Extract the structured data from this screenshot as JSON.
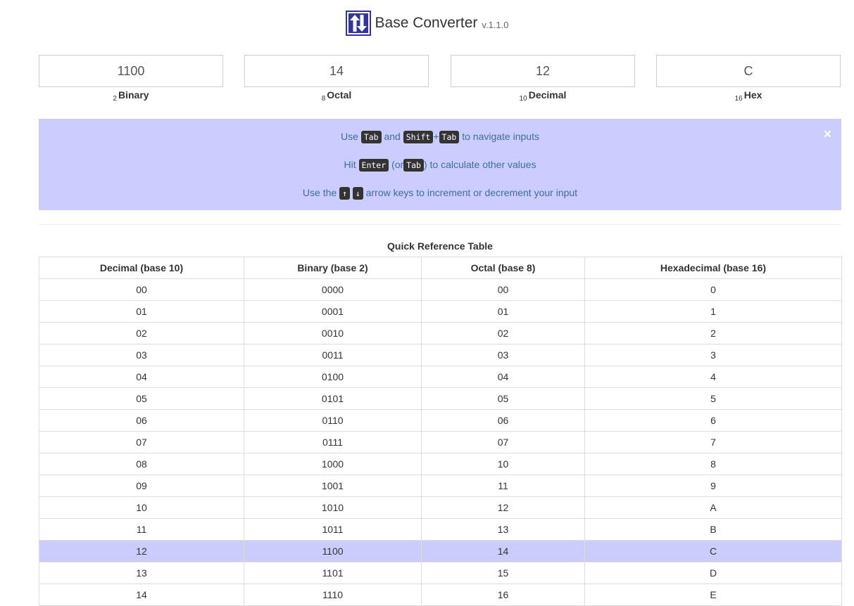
{
  "app": {
    "title": "Base Converter",
    "version": "v.1.1.0"
  },
  "converters": [
    {
      "value": "1100",
      "base": "2",
      "label": "Binary"
    },
    {
      "value": "14",
      "base": "8",
      "label": "Octal"
    },
    {
      "value": "12",
      "base": "10",
      "label": "Decimal"
    },
    {
      "value": "C",
      "base": "16",
      "label": "Hex"
    }
  ],
  "hints": {
    "l1_use": "Use",
    "l1_and": "and",
    "l1_plus": "+",
    "l1_end": "to navigate inputs",
    "l2_hit": "Hit",
    "l2_or": "(or",
    "l2_end": ") to calculate other values",
    "l3_use": "Use the",
    "l3_end": "arrow keys to increment or decrement your input",
    "keys": {
      "tab": "Tab",
      "shift": "Shift",
      "enter": "Enter",
      "up": "↑",
      "down": "↓"
    },
    "close": "×"
  },
  "table": {
    "caption": "Quick Reference Table",
    "headers": [
      "Decimal (base 10)",
      "Binary (base 2)",
      "Octal (base 8)",
      "Hexadecimal (base 16)"
    ],
    "highlight_row": 12,
    "highlight_color": "#ccccff",
    "rows": [
      [
        "00",
        "0000",
        "00",
        "0"
      ],
      [
        "01",
        "0001",
        "01",
        "1"
      ],
      [
        "02",
        "0010",
        "02",
        "2"
      ],
      [
        "03",
        "0011",
        "03",
        "3"
      ],
      [
        "04",
        "0100",
        "04",
        "4"
      ],
      [
        "05",
        "0101",
        "05",
        "5"
      ],
      [
        "06",
        "0110",
        "06",
        "6"
      ],
      [
        "07",
        "0111",
        "07",
        "7"
      ],
      [
        "08",
        "1000",
        "10",
        "8"
      ],
      [
        "09",
        "1001",
        "11",
        "9"
      ],
      [
        "10",
        "1010",
        "12",
        "A"
      ],
      [
        "11",
        "1011",
        "13",
        "B"
      ],
      [
        "12",
        "1100",
        "14",
        "C"
      ],
      [
        "13",
        "1101",
        "15",
        "D"
      ],
      [
        "14",
        "1110",
        "16",
        "E"
      ]
    ]
  },
  "colors": {
    "accent": "#333399",
    "alert_bg": "#ccccff",
    "alert_text": "#3d6ea0"
  }
}
